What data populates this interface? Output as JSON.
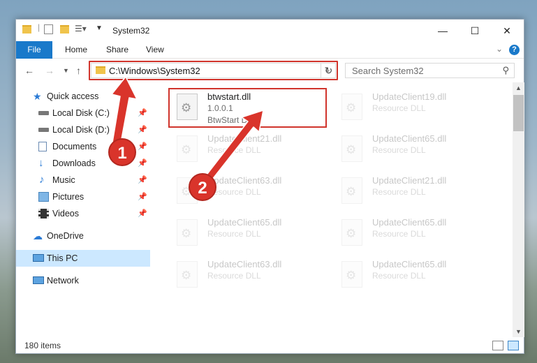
{
  "window": {
    "title": "System32",
    "controls": {
      "minimize": "—",
      "maximize": "☐",
      "close": "✕"
    }
  },
  "ribbon": {
    "tabs": [
      "File",
      "Home",
      "Share",
      "View"
    ],
    "help": "?"
  },
  "address": {
    "path": "C:\\Windows\\System32",
    "search_placeholder": "Search System32"
  },
  "sidebar": {
    "items": [
      {
        "label": "Quick access",
        "icon": "star-icon"
      },
      {
        "label": "Local Disk (C:)",
        "icon": "drive-icon",
        "pinned": true
      },
      {
        "label": "Local Disk (D:)",
        "icon": "drive-icon",
        "pinned": true
      },
      {
        "label": "Documents",
        "icon": "documents-icon",
        "pinned": true
      },
      {
        "label": "Downloads",
        "icon": "download-arrow-icon",
        "pinned": true
      },
      {
        "label": "Music",
        "icon": "music-note-icon",
        "pinned": true
      },
      {
        "label": "Pictures",
        "icon": "pictures-icon",
        "pinned": true
      },
      {
        "label": "Videos",
        "icon": "film-icon",
        "pinned": true
      },
      {
        "label": "OneDrive",
        "icon": "cloud-icon"
      },
      {
        "label": "This PC",
        "icon": "monitor-icon",
        "selected": true
      },
      {
        "label": "Network",
        "icon": "network-icon"
      }
    ]
  },
  "files": [
    {
      "name": "btwstart.dll",
      "line2": "1.0.0.1",
      "line3": "BtwStart DLL",
      "highlighted": true
    },
    {
      "name": "UpdateClient19.dll",
      "line2": "Resource DLL"
    },
    {
      "name": "UpdateClient21.dll",
      "line2": "Resource DLL"
    },
    {
      "name": "UpdateClient65.dll",
      "line2": "Resource DLL"
    },
    {
      "name": "UpdateClient63.dll",
      "line2": "Resource DLL"
    },
    {
      "name": "UpdateClient21.dll",
      "line2": "Resource DLL"
    },
    {
      "name": "UpdateClient65.dll",
      "line2": "Resource DLL"
    },
    {
      "name": "UpdateClient65.dll",
      "line2": "Resource DLL"
    },
    {
      "name": "UpdateClient63.dll",
      "line2": "Resource DLL"
    },
    {
      "name": "UpdateClient65.dll",
      "line2": "Resource DLL"
    }
  ],
  "status": {
    "item_count": "180 items"
  },
  "annotations": {
    "badge1": "1",
    "badge2": "2",
    "color": "#d9342b"
  },
  "colors": {
    "accent": "#1979ca",
    "selected_bg": "#cce8ff",
    "highlight": "#d0342c"
  }
}
